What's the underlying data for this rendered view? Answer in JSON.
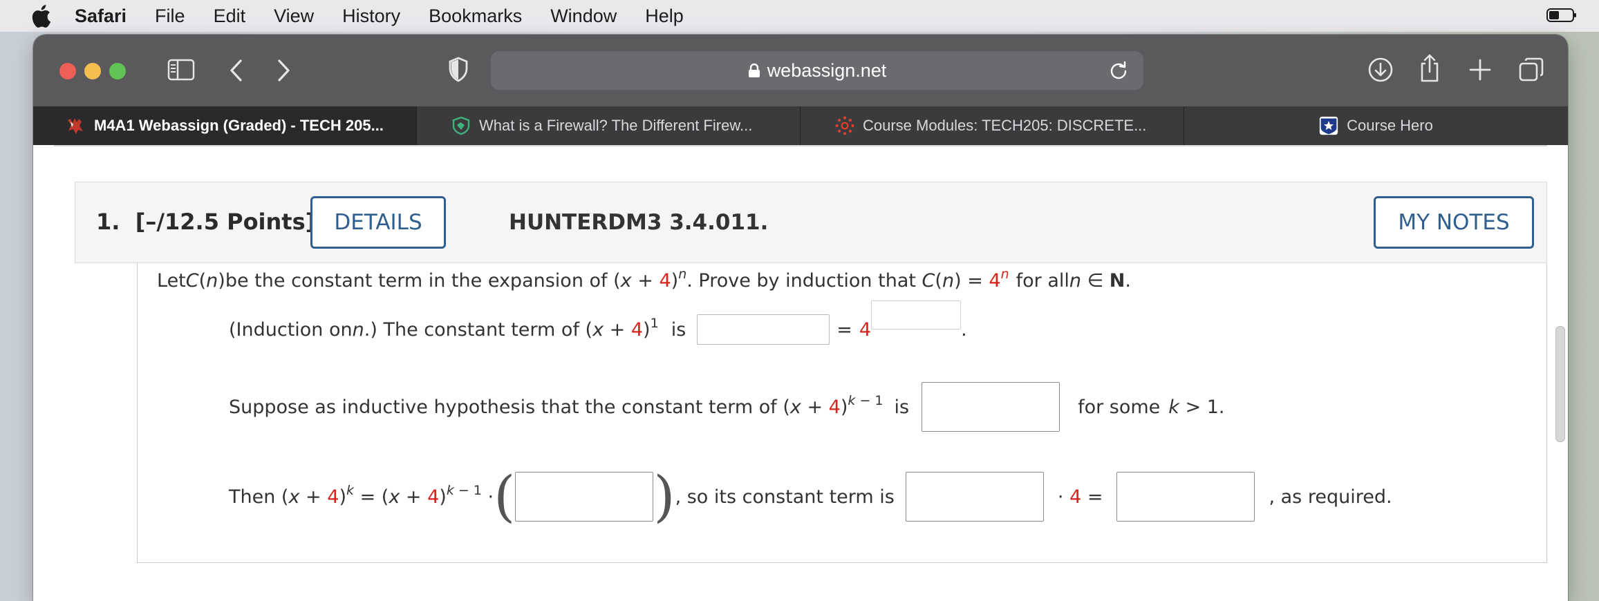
{
  "menubar": {
    "app": "Safari",
    "items": [
      "File",
      "Edit",
      "View",
      "History",
      "Bookmarks",
      "Window",
      "Help"
    ]
  },
  "toolbar": {
    "url": "webassign.net"
  },
  "tabs": [
    {
      "title": "M4A1 Webassign (Graded) - TECH 205...",
      "active": true
    },
    {
      "title": "What is a Firewall? The Different Firew...",
      "active": false
    },
    {
      "title": "Course Modules: TECH205: DISCRETE...",
      "active": false
    },
    {
      "title": "Course Hero",
      "active": false
    }
  ],
  "question": {
    "number": "1.",
    "points": "[–/12.5 Points]",
    "details_label": "DETAILS",
    "code": "HUNTERDM3 3.4.011.",
    "my_notes_label": "MY NOTES",
    "statement": {
      "p1": "Let ",
      "p2": " be the constant term in the expansion of ",
      "p3": ". Prove by induction that ",
      "p4": " for all ",
      "p5": "."
    },
    "base_case": {
      "prefix": "(Induction on ",
      "mid": ".) The constant term of ",
      "is": "is",
      "equals": "=",
      "four": "4",
      "end": "."
    },
    "hypothesis": {
      "prefix": "Suppose as inductive hypothesis that the constant term of ",
      "is": "is",
      "suffix": "for some",
      "cond": "k > 1."
    },
    "step": {
      "prefix": "Then",
      "so": ", so its constant term is",
      "times4": "· 4 =",
      "required": ", as required."
    }
  },
  "colors": {
    "accent_blue": "#2e5f8e",
    "math_red": "#d4261c"
  }
}
